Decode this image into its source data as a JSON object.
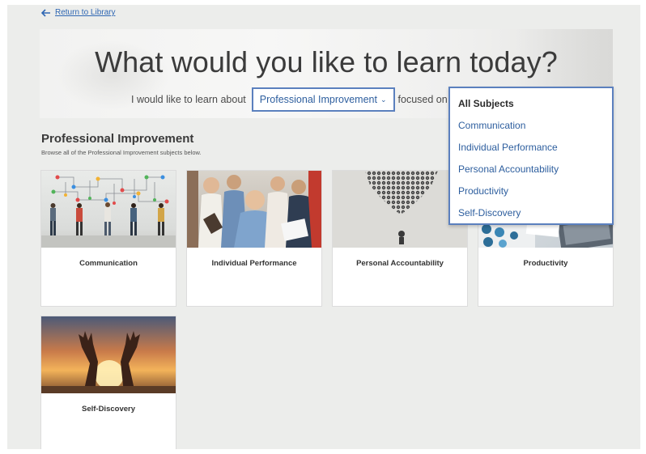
{
  "nav": {
    "back_label": "Return to Library"
  },
  "hero": {
    "title": "What would you like to learn today?",
    "prefix": "I would like to learn about",
    "selected": "Professional Improvement",
    "suffix": "focused on"
  },
  "section": {
    "title": "Professional Improvement",
    "subtitle": "Browse all of the Professional Improvement subjects below."
  },
  "cards": [
    {
      "label": "Communication"
    },
    {
      "label": "Individual Performance"
    },
    {
      "label": "Personal Accountability"
    },
    {
      "label": "Productivity"
    },
    {
      "label": "Self-Discovery"
    }
  ],
  "dropdown": {
    "options": [
      "All Subjects",
      "Communication",
      "Individual Performance",
      "Personal Accountability",
      "Productivity",
      "Self-Discovery"
    ],
    "selected_index": 0
  },
  "colors": {
    "accent": "#5b80be",
    "link": "#2f67b3",
    "background": "#ecedeb"
  }
}
